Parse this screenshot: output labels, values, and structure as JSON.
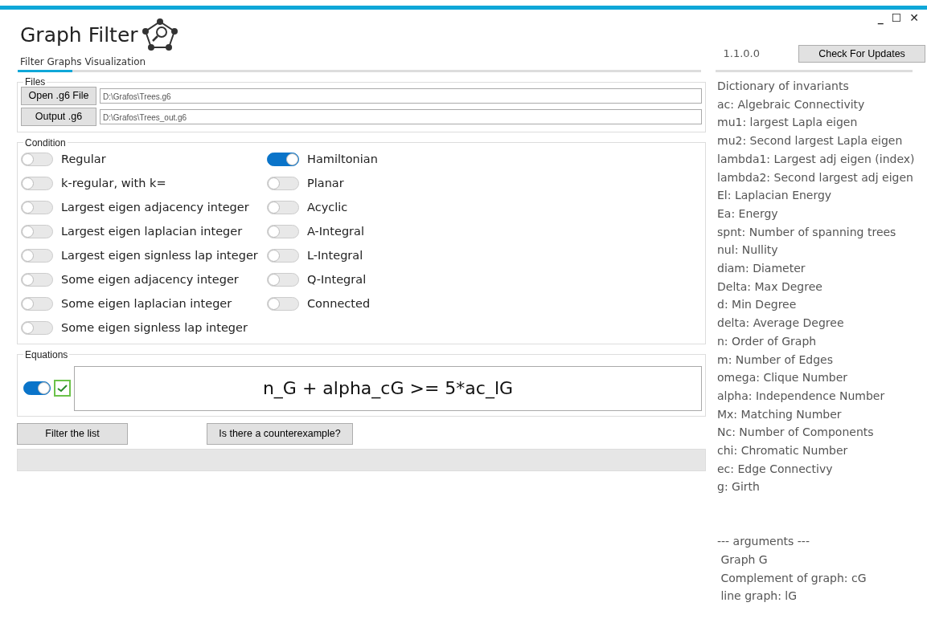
{
  "window": {
    "controls": [
      "_",
      "☐",
      "✕"
    ]
  },
  "header": {
    "title": "Graph Filter",
    "subtitle": "Filter Graphs Visualization",
    "version": "1.1.0.0",
    "update_button": "Check For Updates"
  },
  "files": {
    "legend": "Files",
    "rows": [
      {
        "button": "Open .g6 File",
        "value": "D:\\Grafos\\Trees.g6"
      },
      {
        "button": "Output .g6",
        "value": "D:\\Grafos\\Trees_out.g6"
      }
    ]
  },
  "condition": {
    "legend": "Condition",
    "columns": [
      [
        {
          "label": "Regular",
          "on": false
        },
        {
          "label": "k-regular, with k=",
          "on": false
        },
        {
          "label": "Largest eigen adjacency integer",
          "on": false
        },
        {
          "label": "Largest eigen laplacian integer",
          "on": false
        },
        {
          "label": "Largest eigen signless lap integer",
          "on": false
        },
        {
          "label": "Some eigen adjacency integer",
          "on": false
        },
        {
          "label": "Some eigen laplacian integer",
          "on": false
        },
        {
          "label": "Some eigen signless lap integer",
          "on": false
        }
      ],
      [
        {
          "label": "Hamiltonian",
          "on": true
        },
        {
          "label": "Planar",
          "on": false
        },
        {
          "label": "Acyclic",
          "on": false
        },
        {
          "label": "A-Integral",
          "on": false
        },
        {
          "label": "L-Integral",
          "on": false
        },
        {
          "label": "Q-Integral",
          "on": false
        },
        {
          "label": "Connected",
          "on": false
        }
      ]
    ]
  },
  "equations": {
    "legend": "Equations",
    "on": true,
    "checked": true,
    "value": "n_G + alpha_cG >= 5*ac_lG"
  },
  "actions": [
    "Filter the list",
    "Is there a counterexample?"
  ],
  "dictionary": {
    "lines": [
      "Dictionary of invariants",
      "ac: Algebraic Connectivity",
      "mu1: largest Lapla eigen",
      "mu2: Second largest Lapla eigen",
      "lambda1: Largest adj eigen (index)",
      "lambda2: Second largest adj eigen",
      "El: Laplacian Energy",
      "Ea: Energy",
      "spnt: Number of spanning trees",
      "nul: Nullity",
      "diam: Diameter",
      "Delta: Max Degree",
      "d: Min Degree",
      "delta: Average Degree",
      "n: Order of Graph",
      "m: Number of Edges",
      "omega: Clique Number",
      "alpha: Independence Number",
      "Mx: Matching Number",
      "Nc: Number of Components",
      "chi: Chromatic Number",
      "ec: Edge Connectivy",
      "g: Girth"
    ],
    "arguments": [
      "--- arguments ---",
      " Graph G",
      " Complement of graph: cG",
      " line graph: lG"
    ]
  }
}
